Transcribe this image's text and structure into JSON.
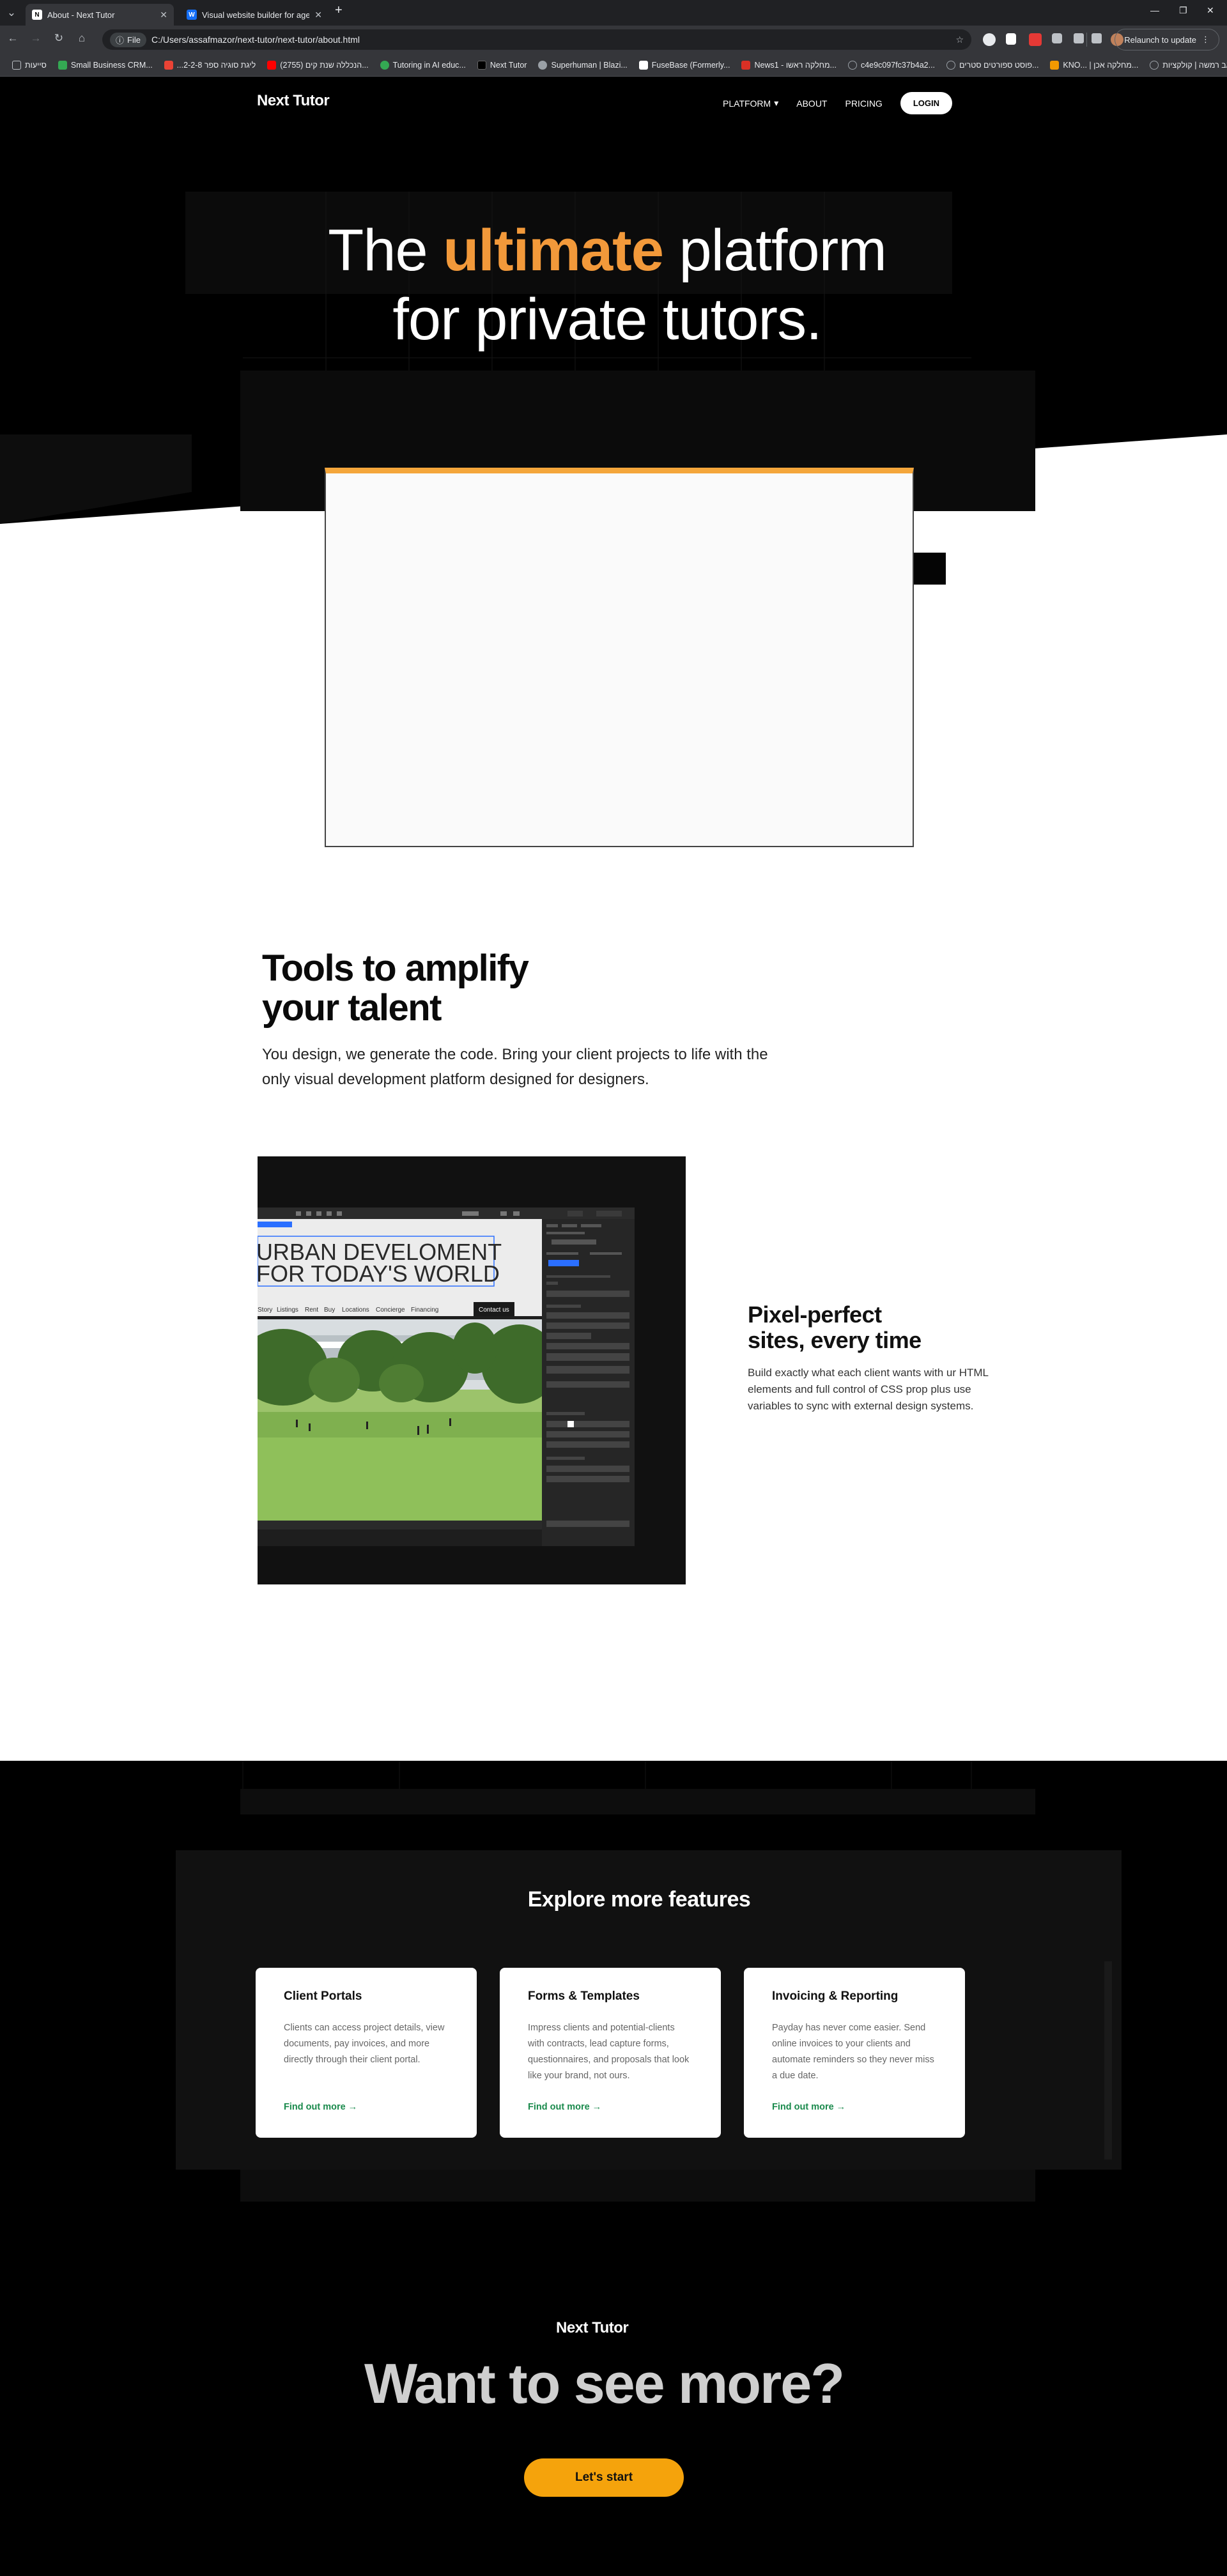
{
  "browser": {
    "tabs": [
      {
        "title": "About - Next Tutor",
        "active": true
      },
      {
        "title": "Visual website builder for agen",
        "active": false
      }
    ],
    "url_prefix": "File",
    "url": "C:/Users/assafmazor/next-tutor/next-tutor/about.html",
    "relaunch_label": "Relaunch to update",
    "bookmarks": [
      {
        "label": "סייעות",
        "color": "#8ab4f8"
      },
      {
        "label": "Small Business CRM...",
        "color": "#34a853"
      },
      {
        "label": "...2-ליגת סוגיה ספר 2-8",
        "color": "#ea4335"
      },
      {
        "label": "(2755) הנכללה שנת קים...",
        "color": "#ff0000"
      },
      {
        "label": "Tutoring in AI educ...",
        "color": "#34a853"
      },
      {
        "label": "Next Tutor",
        "color": "#000000"
      },
      {
        "label": "Superhuman | Blazi...",
        "color": "#9aa0a6"
      },
      {
        "label": "FuseBase (Formerly...",
        "color": "#ffffff"
      },
      {
        "label": "News1 - מחלקה ראשו...",
        "color": "#d93025"
      },
      {
        "label": "c4e9c097fc37b4a2...",
        "color": "#9aa0a6"
      },
      {
        "label": "פוסט ספורטים סטרים...",
        "color": "#9aa0a6"
      },
      {
        "label": "KNO... | מחלקה אכן...",
        "color": "#f29900"
      },
      {
        "label": "נאב רמשה | קולקציות...",
        "color": "#9aa0a6"
      }
    ]
  },
  "site": {
    "logo": "Next Tutor",
    "nav": {
      "platform": "PLATFORM",
      "about": "ABOUT",
      "pricing": "PRICING",
      "login": "LOGIN"
    },
    "hero": {
      "line1_start": "The ",
      "line1_accent": "ultimate",
      "line1_end": " platform",
      "line2": "for private tutors."
    },
    "tools": {
      "title_line1": "Tools to amplify",
      "title_line2": "your talent",
      "body": "You design, we generate the code. Bring your client projects to life with the only visual development platform designed for designers."
    },
    "screenshot": {
      "headline1": "URBAN DEVELOMENT",
      "headline2": "FOR TODAY'S WORLD",
      "menu": [
        "Story",
        "Listings",
        "Rent",
        "Buy",
        "Locations",
        "Concierge",
        "Financing"
      ],
      "contact": "Contact us"
    },
    "pixel": {
      "title_line1": "Pixel-perfect",
      "title_line2": "sites, every time",
      "body": "Build exactly what each client wants with ur HTML elements and full control of CSS prop plus use variables to sync with external design systems."
    },
    "features": {
      "title": "Explore more features",
      "cards": [
        {
          "title": "Client Portals",
          "body": "Clients can access project details, view documents, pay invoices, and more directly through their client portal.",
          "link": "Find out more →"
        },
        {
          "title": "Forms & Templates",
          "body": "Impress clients and potential-clients with contracts, lead capture forms, questionnaires, and proposals that look like your brand, not ours.",
          "link": "Find out more →"
        },
        {
          "title": "Invoicing & Reporting",
          "body": "Payday has never come easier. Send online invoices to your clients and automate reminders so they never miss a due date.",
          "link": "Find out more →"
        }
      ]
    },
    "cta": {
      "logo": "Next Tutor",
      "title": "Want to see more?",
      "button": "Let's start"
    },
    "colors": {
      "accent": "#f2993a",
      "top_bar": "#f4a63b",
      "cta_button": "#f5a30c",
      "link": "#1a8a4c"
    }
  }
}
